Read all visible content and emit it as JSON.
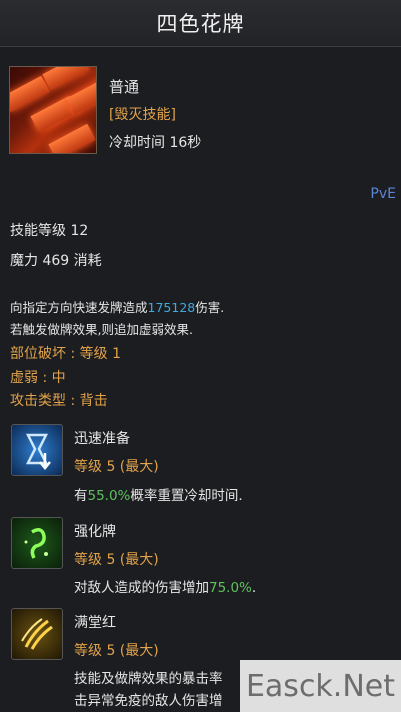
{
  "header": {
    "title": "四色花牌"
  },
  "skill": {
    "icon": "four-color-cards-icon",
    "grade": "普通",
    "type": "[毁灭技能]",
    "cooldown": "冷却时间 16秒",
    "mode": "PvE",
    "level": "技能等级 12",
    "mana": "魔力 469 消耗"
  },
  "description": {
    "line1_pre": "向指定方向快速发牌造成",
    "line1_value": "175128",
    "line1_post": "伤害.",
    "line2": "若触发做牌效果,则追加虚弱效果."
  },
  "attributes": {
    "part_break": "部位破坏 : 等级 1",
    "weak": "虚弱 : 中",
    "attack_type": "攻击类型 : 背击"
  },
  "traits": [
    {
      "icon": "hourglass-icon",
      "name": "迅速准备",
      "level": "等级 5 (最大)",
      "desc_pre": "有",
      "desc_value": "55.0%",
      "desc_post": "概率重置冷却时间."
    },
    {
      "icon": "glowing-rune-icon",
      "name": "强化牌",
      "level": "等级 5 (最大)",
      "desc_pre": "对敌人造成的伤害增加",
      "desc_value": "75.0%",
      "desc_post": "."
    },
    {
      "icon": "claw-slash-icon",
      "name": "满堂红",
      "level": "等级 5 (最大)",
      "desc_line1": "技能及做牌效果的暴击率",
      "desc_line2": "击异常免疫的敌人伤害增"
    }
  ],
  "watermark": "Easck.Net",
  "colors": {
    "background": "#1c1d20",
    "gold": "#e2a34a",
    "value_blue": "#41a9e0",
    "value_green": "#5ec15e",
    "pve_blue": "#5b86d6"
  }
}
